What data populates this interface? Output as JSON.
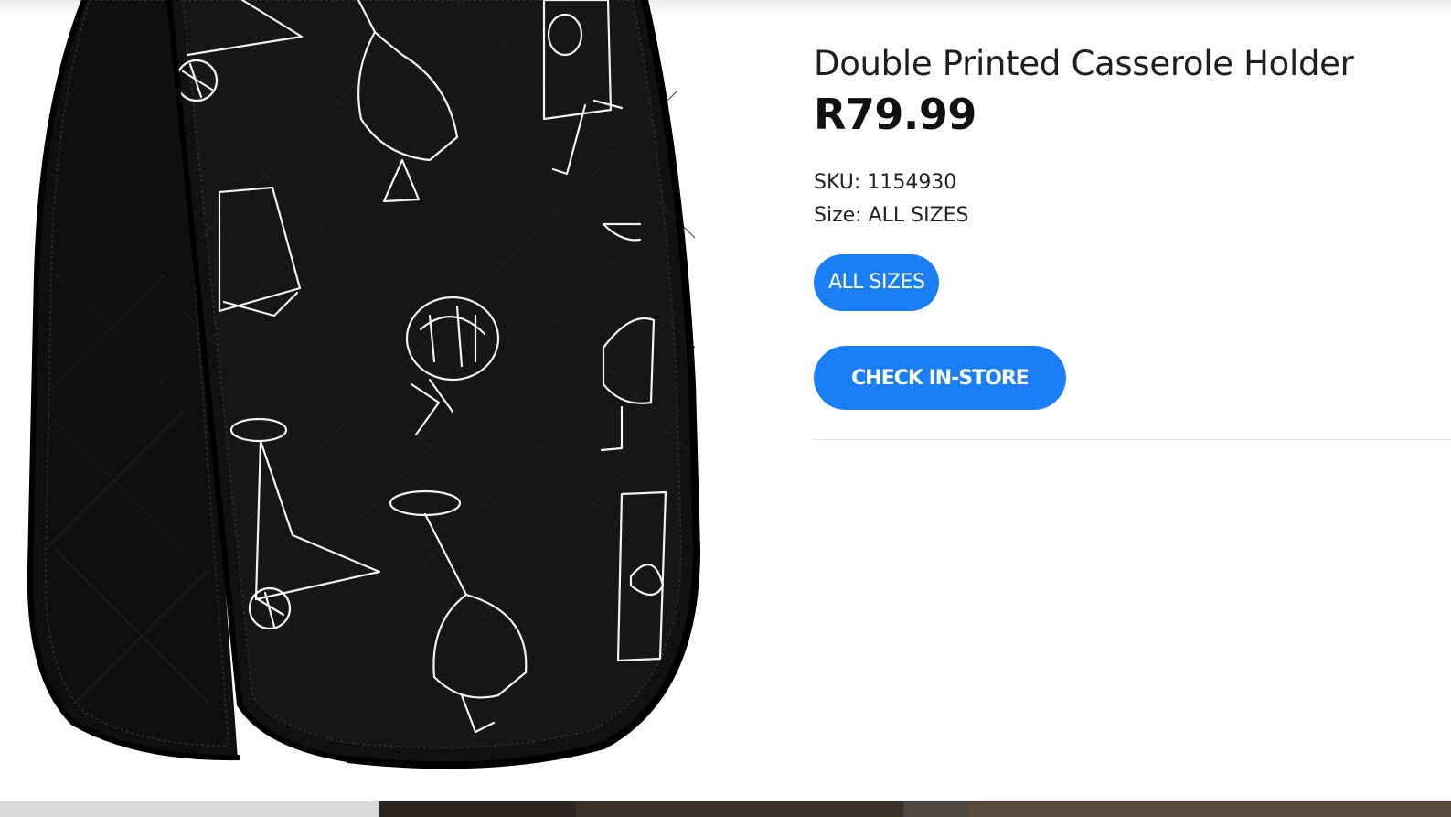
{
  "product": {
    "title": "Double Printed Casserole Holder",
    "price": "R79.99",
    "sku_label": "SKU:",
    "sku_value": "1154930",
    "size_label": "Size:",
    "size_value": "ALL SIZES"
  },
  "size_options": [
    {
      "label": "ALL SIZES",
      "selected": true
    }
  ],
  "actions": {
    "check_in_store_label": "CHECK IN-STORE"
  },
  "colors": {
    "accent": "#1a7ff5",
    "product_fabric": "#0d0d0d",
    "print": "#f2f2f2"
  },
  "image": {
    "subject": "black double oven glove with white drinking glasses print"
  }
}
